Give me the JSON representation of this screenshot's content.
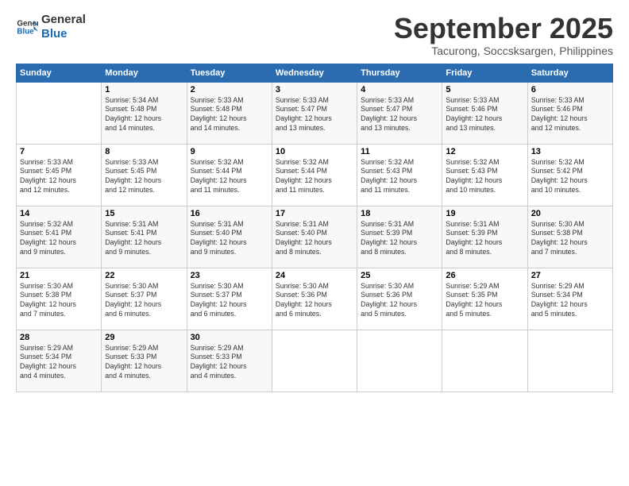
{
  "logo": {
    "line1": "General",
    "line2": "Blue"
  },
  "title": "September 2025",
  "location": "Tacurong, Soccsksargen, Philippines",
  "days_of_week": [
    "Sunday",
    "Monday",
    "Tuesday",
    "Wednesday",
    "Thursday",
    "Friday",
    "Saturday"
  ],
  "weeks": [
    [
      {
        "day": "",
        "info": ""
      },
      {
        "day": "1",
        "info": "Sunrise: 5:34 AM\nSunset: 5:48 PM\nDaylight: 12 hours\nand 14 minutes."
      },
      {
        "day": "2",
        "info": "Sunrise: 5:33 AM\nSunset: 5:48 PM\nDaylight: 12 hours\nand 14 minutes."
      },
      {
        "day": "3",
        "info": "Sunrise: 5:33 AM\nSunset: 5:47 PM\nDaylight: 12 hours\nand 13 minutes."
      },
      {
        "day": "4",
        "info": "Sunrise: 5:33 AM\nSunset: 5:47 PM\nDaylight: 12 hours\nand 13 minutes."
      },
      {
        "day": "5",
        "info": "Sunrise: 5:33 AM\nSunset: 5:46 PM\nDaylight: 12 hours\nand 13 minutes."
      },
      {
        "day": "6",
        "info": "Sunrise: 5:33 AM\nSunset: 5:46 PM\nDaylight: 12 hours\nand 12 minutes."
      }
    ],
    [
      {
        "day": "7",
        "info": "Sunrise: 5:33 AM\nSunset: 5:45 PM\nDaylight: 12 hours\nand 12 minutes."
      },
      {
        "day": "8",
        "info": "Sunrise: 5:33 AM\nSunset: 5:45 PM\nDaylight: 12 hours\nand 12 minutes."
      },
      {
        "day": "9",
        "info": "Sunrise: 5:32 AM\nSunset: 5:44 PM\nDaylight: 12 hours\nand 11 minutes."
      },
      {
        "day": "10",
        "info": "Sunrise: 5:32 AM\nSunset: 5:44 PM\nDaylight: 12 hours\nand 11 minutes."
      },
      {
        "day": "11",
        "info": "Sunrise: 5:32 AM\nSunset: 5:43 PM\nDaylight: 12 hours\nand 11 minutes."
      },
      {
        "day": "12",
        "info": "Sunrise: 5:32 AM\nSunset: 5:43 PM\nDaylight: 12 hours\nand 10 minutes."
      },
      {
        "day": "13",
        "info": "Sunrise: 5:32 AM\nSunset: 5:42 PM\nDaylight: 12 hours\nand 10 minutes."
      }
    ],
    [
      {
        "day": "14",
        "info": "Sunrise: 5:32 AM\nSunset: 5:41 PM\nDaylight: 12 hours\nand 9 minutes."
      },
      {
        "day": "15",
        "info": "Sunrise: 5:31 AM\nSunset: 5:41 PM\nDaylight: 12 hours\nand 9 minutes."
      },
      {
        "day": "16",
        "info": "Sunrise: 5:31 AM\nSunset: 5:40 PM\nDaylight: 12 hours\nand 9 minutes."
      },
      {
        "day": "17",
        "info": "Sunrise: 5:31 AM\nSunset: 5:40 PM\nDaylight: 12 hours\nand 8 minutes."
      },
      {
        "day": "18",
        "info": "Sunrise: 5:31 AM\nSunset: 5:39 PM\nDaylight: 12 hours\nand 8 minutes."
      },
      {
        "day": "19",
        "info": "Sunrise: 5:31 AM\nSunset: 5:39 PM\nDaylight: 12 hours\nand 8 minutes."
      },
      {
        "day": "20",
        "info": "Sunrise: 5:30 AM\nSunset: 5:38 PM\nDaylight: 12 hours\nand 7 minutes."
      }
    ],
    [
      {
        "day": "21",
        "info": "Sunrise: 5:30 AM\nSunset: 5:38 PM\nDaylight: 12 hours\nand 7 minutes."
      },
      {
        "day": "22",
        "info": "Sunrise: 5:30 AM\nSunset: 5:37 PM\nDaylight: 12 hours\nand 6 minutes."
      },
      {
        "day": "23",
        "info": "Sunrise: 5:30 AM\nSunset: 5:37 PM\nDaylight: 12 hours\nand 6 minutes."
      },
      {
        "day": "24",
        "info": "Sunrise: 5:30 AM\nSunset: 5:36 PM\nDaylight: 12 hours\nand 6 minutes."
      },
      {
        "day": "25",
        "info": "Sunrise: 5:30 AM\nSunset: 5:36 PM\nDaylight: 12 hours\nand 5 minutes."
      },
      {
        "day": "26",
        "info": "Sunrise: 5:29 AM\nSunset: 5:35 PM\nDaylight: 12 hours\nand 5 minutes."
      },
      {
        "day": "27",
        "info": "Sunrise: 5:29 AM\nSunset: 5:34 PM\nDaylight: 12 hours\nand 5 minutes."
      }
    ],
    [
      {
        "day": "28",
        "info": "Sunrise: 5:29 AM\nSunset: 5:34 PM\nDaylight: 12 hours\nand 4 minutes."
      },
      {
        "day": "29",
        "info": "Sunrise: 5:29 AM\nSunset: 5:33 PM\nDaylight: 12 hours\nand 4 minutes."
      },
      {
        "day": "30",
        "info": "Sunrise: 5:29 AM\nSunset: 5:33 PM\nDaylight: 12 hours\nand 4 minutes."
      },
      {
        "day": "",
        "info": ""
      },
      {
        "day": "",
        "info": ""
      },
      {
        "day": "",
        "info": ""
      },
      {
        "day": "",
        "info": ""
      }
    ]
  ]
}
